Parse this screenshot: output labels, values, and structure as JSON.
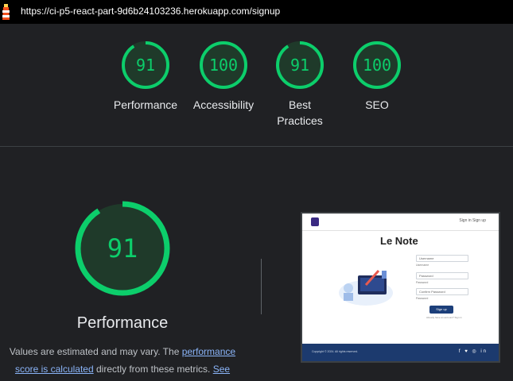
{
  "header": {
    "url": "https://ci-p5-react-part-9d6b24103236.herokuapp.com/signup"
  },
  "scores": [
    {
      "label": "Performance",
      "value": "91",
      "fraction": 0.91
    },
    {
      "label": "Accessibility",
      "value": "100",
      "fraction": 1.0
    },
    {
      "label": "Best Practices",
      "value": "91",
      "fraction": 0.91
    },
    {
      "label": "SEO",
      "value": "100",
      "fraction": 1.0
    }
  ],
  "main": {
    "score": "91",
    "fraction": 0.91,
    "title": "Performance",
    "note_prefix": "Values are estimated and may vary. The ",
    "note_link1": "performance score is calculated",
    "note_mid": " directly from these metrics. ",
    "note_link2": "See calculator."
  },
  "preview": {
    "app_title": "Le Note",
    "nav_links": "Sign in   Sign up",
    "username_placeholder": "Username",
    "username_caption": "Username",
    "password_placeholder": "Password",
    "password_caption": "Password",
    "confirm_placeholder": "Confirm Password",
    "confirm_caption": "Password",
    "signup_button": "Sign up",
    "signin_prompt": "Already have an account? Sign in",
    "footer_text": "Copyright © 2024. All rights reserved.",
    "footer_icons": "f ♥ ◎ in"
  },
  "colors": {
    "pass_green": "#0cce6b",
    "ring_bg": "#1f3a2a",
    "background": "#202124"
  }
}
